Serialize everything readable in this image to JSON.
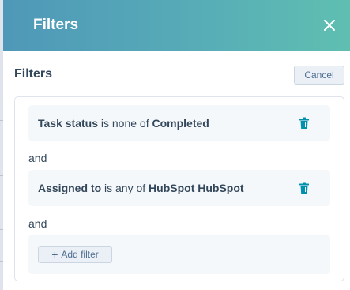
{
  "header": {
    "title": "Filters",
    "close_icon": "close-icon"
  },
  "subheader": {
    "title": "Filters",
    "cancel_label": "Cancel"
  },
  "filters": [
    {
      "property": "Task status",
      "operator": "is none of",
      "value": "Completed",
      "delete_icon": "trash-icon"
    },
    {
      "property": "Assigned to",
      "operator": "is any of",
      "value": "HubSpot HubSpot",
      "delete_icon": "trash-icon"
    }
  ],
  "connectors": [
    "and",
    "and"
  ],
  "add_filter": {
    "icon": "plus-icon",
    "label": "Add filter"
  },
  "colors": {
    "header_start": "#4f98b8",
    "header_end": "#5fbfb1",
    "text": "#33475b",
    "trash": "#0091ae",
    "card_bg": "#f5f8fa",
    "button_bg": "#eaf0f6"
  }
}
